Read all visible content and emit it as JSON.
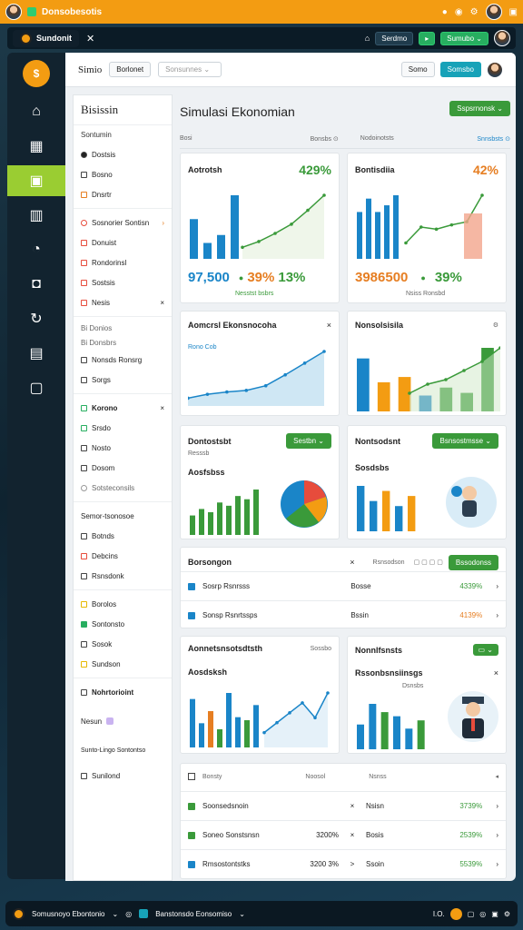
{
  "topbar": {
    "title": "Donsobesotis",
    "icons": [
      "avatar",
      "app-icon",
      "bell-icon",
      "info-icon",
      "settings-icon",
      "close-icon"
    ]
  },
  "appbar": {
    "tab": "Sundonit",
    "btn1": "Serdmo",
    "btn2": "Sumubo"
  },
  "rail": {
    "items": [
      "logo",
      "home-icon",
      "building-icon",
      "chart-icon",
      "calendar-icon",
      "chat-icon",
      "wallet-icon",
      "refresh-icon",
      "document-icon",
      "report-icon"
    ]
  },
  "header": {
    "brand": "Simio",
    "btn": "Borlonet",
    "select_placeholder": "Sonsunnes",
    "btn2": "Somo",
    "btn3": "Somsbo"
  },
  "nav": {
    "title": "Bisissin",
    "items": [
      {
        "label": "Sontumin"
      },
      {
        "label": "Dostsis"
      },
      {
        "label": "Bosno"
      },
      {
        "label": "Dnsrtr"
      },
      {
        "label": "Sosnorier Sontisn"
      },
      {
        "label": "Donuist"
      },
      {
        "label": "Rondorinsl"
      },
      {
        "label": "Sostsis"
      },
      {
        "label": "Nesis"
      },
      {
        "label": "Bi Donios"
      },
      {
        "label": "Bi Donsbrs"
      },
      {
        "label": "Nonsds Ronsrg"
      },
      {
        "label": "Sorgs"
      },
      {
        "label": "Korono"
      },
      {
        "label": "Srsdo"
      },
      {
        "label": "Nosto"
      },
      {
        "label": "Dosom"
      },
      {
        "label": "Sotsteconsils"
      },
      {
        "label": "Semor-tsonosoe"
      },
      {
        "label": "Botnds"
      },
      {
        "label": "Debcins"
      },
      {
        "label": "Rsnsdonk"
      },
      {
        "label": "Borolos"
      },
      {
        "label": "Sontonsto"
      },
      {
        "label": "Sosok"
      },
      {
        "label": "Sundson"
      },
      {
        "label": "Nohrtorioint"
      },
      {
        "label": "Nesun"
      },
      {
        "label": "Sunto-Lingo Sontontso"
      },
      {
        "label": "Sunilond"
      }
    ]
  },
  "content": {
    "title": "Simulasi Ekonomian",
    "cta": "Sspsrnonsk",
    "cards": {
      "c1": {
        "title": "Aotrotsh",
        "pct": "429%",
        "big": "97,500",
        "kpi": "39%",
        "kpi2": "13%",
        "foot": "Nesstst bsbrs",
        "tag": "Bosi"
      },
      "c2": {
        "title": "Bontisdiia",
        "pct": "42%",
        "big": "3986500",
        "kpi": "39%",
        "foot": "Nsiss Ronsbd",
        "tag": "Nodoinotsts",
        "tag2": "Snnsbsts"
      },
      "c3": {
        "title": "Aomcrsl Ekonsnocoha",
        "ylabel": "Rono Cob"
      },
      "c4": {
        "title": "Nonsolsisila"
      },
      "c5": {
        "title": "Dontostsbt",
        "sub": "Resssb",
        "btn": "Sestbn",
        "inner": "Aosfsbss"
      },
      "c6": {
        "title": "Nontsodsnt",
        "btn": "Bsnsostmsse",
        "inner": "Sosdsbs"
      },
      "table1": {
        "title": "Borsongon",
        "col": "Rsnsodson",
        "btn": "Bssodonss",
        "rows": [
          {
            "label": "Sosrp Rsnrsss",
            "mid": "Bosse",
            "val": "4339%"
          },
          {
            "label": "Sonsp Rsnrtssps",
            "mid": "Bssin",
            "val": "4139%"
          }
        ]
      },
      "c7": {
        "title": "Aonnetsnsotsdtsth",
        "sub": "Sossbo",
        "inner": "Aosdsksh"
      },
      "c8": {
        "title": "Nonnlfsnsts",
        "inner": "Rssonbsnsiinsgs",
        "sub": "Dsnsbs"
      },
      "table2": {
        "h1": "Bonsty",
        "h2": "Noosol",
        "h3": "Nsnss",
        "rows": [
          {
            "label": "Soonsedsnoin",
            "mid": "",
            "mark": "×",
            "mid2": "Nsisn",
            "val": "3739%"
          },
          {
            "label": "Soneo Sonstsnsn",
            "mid": "3200%",
            "mark": "×",
            "mid2": "Bosis",
            "val": "2539%"
          },
          {
            "label": "Rmsostontstks",
            "mid": "3200 3%",
            "mark": ">",
            "mid2": "Ssoin",
            "val": "5539%"
          }
        ]
      }
    }
  },
  "taskbar": {
    "item1": "Somusnoyo Ebontonio",
    "item2": "Banstonsdo Eonsomiso",
    "clock": "I.O."
  },
  "chart_data": [
    {
      "type": "bar",
      "series": [
        {
          "values": [
            100,
            40,
            60,
            160
          ]
        }
      ]
    },
    {
      "type": "bar",
      "series": [
        {
          "values": [
            70,
            90,
            70,
            80,
            95
          ]
        }
      ]
    },
    {
      "type": "area",
      "series": [
        {
          "values": [
            10,
            15,
            18,
            20,
            26,
            40,
            55,
            70
          ]
        }
      ]
    },
    {
      "type": "bar",
      "series": [
        {
          "values": [
            100,
            55,
            65,
            30,
            45,
            35,
            120
          ]
        }
      ]
    },
    {
      "type": "bar",
      "series": [
        {
          "values": [
            30,
            40,
            35,
            50,
            45,
            60,
            55,
            70
          ]
        }
      ]
    },
    {
      "type": "bar",
      "series": [
        {
          "values": [
            45,
            30,
            40,
            25,
            35
          ]
        }
      ]
    },
    {
      "type": "bar",
      "series": [
        {
          "values": [
            80,
            40,
            60,
            30,
            90,
            50,
            45,
            70
          ]
        }
      ]
    },
    {
      "type": "bar",
      "series": [
        {
          "values": [
            30,
            55,
            45,
            40,
            25,
            35
          ]
        }
      ]
    }
  ]
}
